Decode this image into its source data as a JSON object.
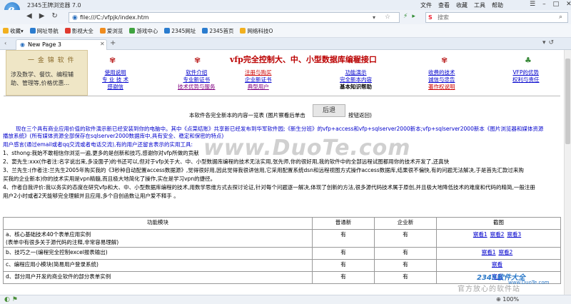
{
  "browser": {
    "app_title": "2345王牌浏览器 7.0",
    "menu": [
      "文件",
      "查看",
      "收藏",
      "工具",
      "帮助"
    ],
    "url": "file:///C:/vfpjk/index.htm",
    "search_placeholder": "搜索",
    "favorites_label": "收藏",
    "favorites": [
      "网址导航",
      "影视大全",
      "爱浏览",
      "游戏中心",
      "2345网址",
      "2345首页",
      "网络科技O"
    ],
    "tab_title": "New Page 3",
    "zoom": "100%"
  },
  "page": {
    "banner_title": "一 金 锦 软 件",
    "banner_lines": [
      "涉及数学、餐饮、编程辅",
      "助、管理等,价格优惠..."
    ],
    "site_title": "vfp完全控制大、中、小型数据库编程接口",
    "nav": [
      {
        "links": [
          {
            "text": "使用说明",
            "color": "blue"
          },
          {
            "text": "专 业 技 术",
            "color": "blue"
          },
          {
            "text": "感谢信",
            "color": "blue"
          }
        ]
      },
      {
        "links": [
          {
            "text": "软件介绍",
            "color": "blue"
          },
          {
            "text": "专业新证书",
            "color": "blue"
          },
          {
            "text": "技术优势与服务",
            "color": "purple"
          }
        ]
      },
      {
        "links": [
          {
            "text": "注册与购买",
            "color": "red"
          },
          {
            "text": "企业新证书",
            "color": "blue"
          },
          {
            "text": "典型用户",
            "color": "purple"
          }
        ]
      },
      {
        "links": [
          {
            "text": "功能演示",
            "color": "blue"
          },
          {
            "text": "完全新本内容",
            "color": "blue"
          },
          {
            "text": "基本知识帮助",
            "color": "black"
          }
        ]
      },
      {
        "links": [
          {
            "text": "收费的技术",
            "color": "blue"
          },
          {
            "text": "诚信与忠告",
            "color": "blue"
          },
          {
            "text": "著作权说明",
            "color": "red"
          }
        ]
      },
      {
        "links": [
          {
            "text": "VFP的优势",
            "color": "blue"
          },
          {
            "text": "权利与责任",
            "color": "blue"
          }
        ]
      }
    ],
    "guide_text": "本软件各完全新本的内容一览表 (图片察看后单击",
    "back_button": "后退",
    "guide_text2": "按钮返回)",
    "intro": "现在三个具有商业应用价值的软件演示新已经安装到你的电脑中。其中《点菜结账》共享新已经发布到华军软件园;《新生分班》的vfp+access和vfp+sqlserver2000新本;vfp+sqlserver2000新本《图片浏览器和媒体资源",
    "intro2": "播放系统》(所有媒体资源全部保存在sqlserver2000数据库中,具有安全、稳定和保密的特点)",
    "users_title": "用户感言(通过email或者qq交流或者电话交流),有的用户还留言表示的实用工具:",
    "user1": "1、sthong:我始不敢相信你浏览一遍,更多的是创新和技巧,感谢你对vfp所做的贡献",
    "user2": "2、窦先生:xxx(作者注:名字说出来,多没面子)的书还可以,但对于vfp关于大、中、小型数据库编程的技术无法实用,张先师,你的很好用,我的软件中的全部远程试图都用你的技术开发了,还真快",
    "user3": "3、兰先生:(作者注:兰先生2005年购买我的《3秒种自动配置access数据源》,觉得很好用,因此觉得我很讲信用,它采用配置系统dsn和远程视图方式操作access数据库,结果很不偏快,有的问题无法解决,于是首先汇款过来购",
    "user3b": "买我的企业新本)你的技术实用是vpn精髓,而且极大地简化了操作,实在是学习vpn的捷径。",
    "user4": "4、作者自我评价:我以务实的态度在研究vfp和大、中、小型数据库编程的技术,用数学思维方式去探讨论证,针对每个问题逐一解决,体现了创新的方法,很多源代码技术属于原创,并且极大地降低技术的难度和代码的精简,一般注册",
    "user4b": "用户2小时或者2天能够完全理解并且应用,多个自创函数让用户爱不释手 。",
    "watermark": "www.DuoTe.com",
    "table": {
      "headers": [
        "功能模块",
        "普通新",
        "企业新",
        "截图"
      ],
      "rows": [
        {
          "module": "a、核心基础技术40个表单应用实例\n(表单中有很多关于源代码的注释,非常容易理解)",
          "normal": "有",
          "enterprise": "有",
          "shots": [
            "察看1",
            "察看2",
            "察看3"
          ]
        },
        {
          "module": "b、技巧之一(编程完全控制excel报表输出)",
          "normal": "有",
          "enterprise": "有",
          "shots": [
            "察看1",
            "察看2"
          ]
        },
        {
          "module": "c、编程应用小模块(简易用户登录系统)",
          "normal": "有",
          "enterprise": "有",
          "shots": [
            "察看"
          ]
        },
        {
          "module": "d、部分用户开发的商业软件的部分表单实例",
          "normal": "有",
          "enterprise": "有",
          "shots": [
            "察看"
          ]
        }
      ]
    },
    "corner_wm_brand": "2345软件大全",
    "corner_wm_url": "www.DuoTe.com",
    "corner_wm_safe": "官方放心的软件站"
  }
}
